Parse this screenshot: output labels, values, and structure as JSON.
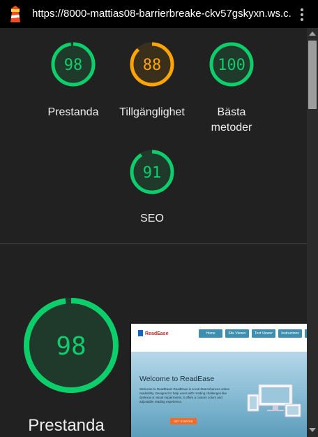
{
  "browser": {
    "url": "https://8000-mattias08-barrierbreake-ckv57gskyxn.ws.c...",
    "logo_icon": "lighthouse-icon",
    "menu_icon": "kebab-menu-icon"
  },
  "gauges": [
    {
      "value": "98",
      "score": 0.98,
      "label": "Prestanda",
      "color": "#0cce6b",
      "bg": "#1f3a2a"
    },
    {
      "value": "88",
      "score": 0.88,
      "label": "Tillgänglighet",
      "color": "#ffa400",
      "bg": "#3a2f1a"
    },
    {
      "value": "100",
      "score": 1.0,
      "label": "Bästa\nmetoder",
      "color": "#0cce6b",
      "bg": "#1f3a2a"
    },
    {
      "value": "91",
      "score": 0.91,
      "label": "SEO",
      "color": "#0cce6b",
      "bg": "#1f3a2a"
    }
  ],
  "detail": {
    "value": "98",
    "score": 0.98,
    "label": "Prestanda",
    "color": "#0cce6b"
  },
  "thumbnail": {
    "brand": "ReadEase",
    "nav": [
      "Home",
      "Site Viewer",
      "Text Viewer",
      "Instructions",
      ""
    ],
    "title": "Welcome to ReadEase",
    "text": "Welcome to ReadEase! ReadEase is a tool that enhances online readability. Designed to help users with reading challenges like dyslexia or visual impairments, it offers a custom colors and adjustable reading experience.",
    "cta": "GET STARTED"
  }
}
